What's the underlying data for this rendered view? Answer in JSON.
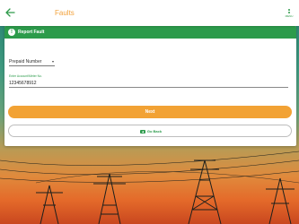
{
  "appbar": {
    "title": "Faults",
    "menu_label": "MENU"
  },
  "card": {
    "title": "Report Fault",
    "info_glyph": "!"
  },
  "type_select": {
    "selected": "Prepaid Number"
  },
  "account_field": {
    "label": "Enter Account/Meter No.",
    "value": "12345678912"
  },
  "buttons": {
    "next_label": "Next",
    "back_label": "Go Back"
  },
  "colors": {
    "brand_green": "#2c9b4b",
    "accent_orange": "#f2a234",
    "title_orange": "#f2a23c"
  },
  "icons": {
    "back": "arrow-left-icon",
    "menu": "menu-dots-icon",
    "info": "info-icon",
    "go_back": "back-arrow-icon"
  }
}
